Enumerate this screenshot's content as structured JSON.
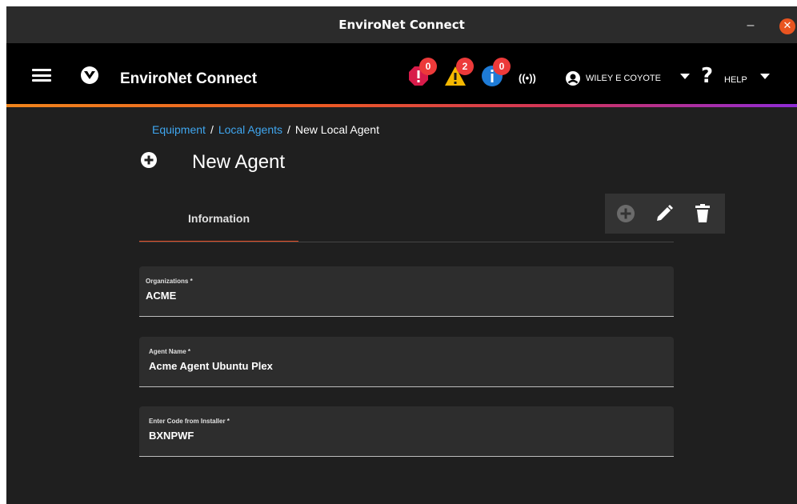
{
  "window": {
    "title": "EnviroNet Connect",
    "minimize_glyph": "–",
    "close_glyph": "✕"
  },
  "header": {
    "brand": "EnviroNet Connect",
    "alerts": [
      {
        "kind": "critical",
        "icon": "critical-alert-icon",
        "count": "0",
        "color": "#d81b4a"
      },
      {
        "kind": "warning",
        "icon": "warning-alert-icon",
        "count": "2",
        "color": "#f5b800"
      },
      {
        "kind": "info",
        "icon": "info-alert-icon",
        "count": "0",
        "color": "#1e7bd6"
      }
    ],
    "wifi_icon_text": "((•))",
    "user_name": "WILEY E COYOTE",
    "help_glyph": "?",
    "help_label": "HELP"
  },
  "breadcrumb": {
    "items": [
      "Equipment",
      "Local Agents",
      "New Local Agent"
    ],
    "separator": "/"
  },
  "page": {
    "title": "New Agent"
  },
  "tabs": [
    {
      "label": "Information",
      "active": true
    }
  ],
  "form": {
    "organizations": {
      "label": "Organizations *",
      "value": "ACME"
    },
    "agent_name": {
      "label": "Agent Name *",
      "value": "Acme Agent Ubuntu Plex"
    },
    "installer_code": {
      "label": "Enter Code from Installer *",
      "value": "BXNPWF"
    }
  },
  "colors": {
    "accent": "#e54d24",
    "link": "#3fa6ef",
    "background": "#1f1f1f"
  }
}
